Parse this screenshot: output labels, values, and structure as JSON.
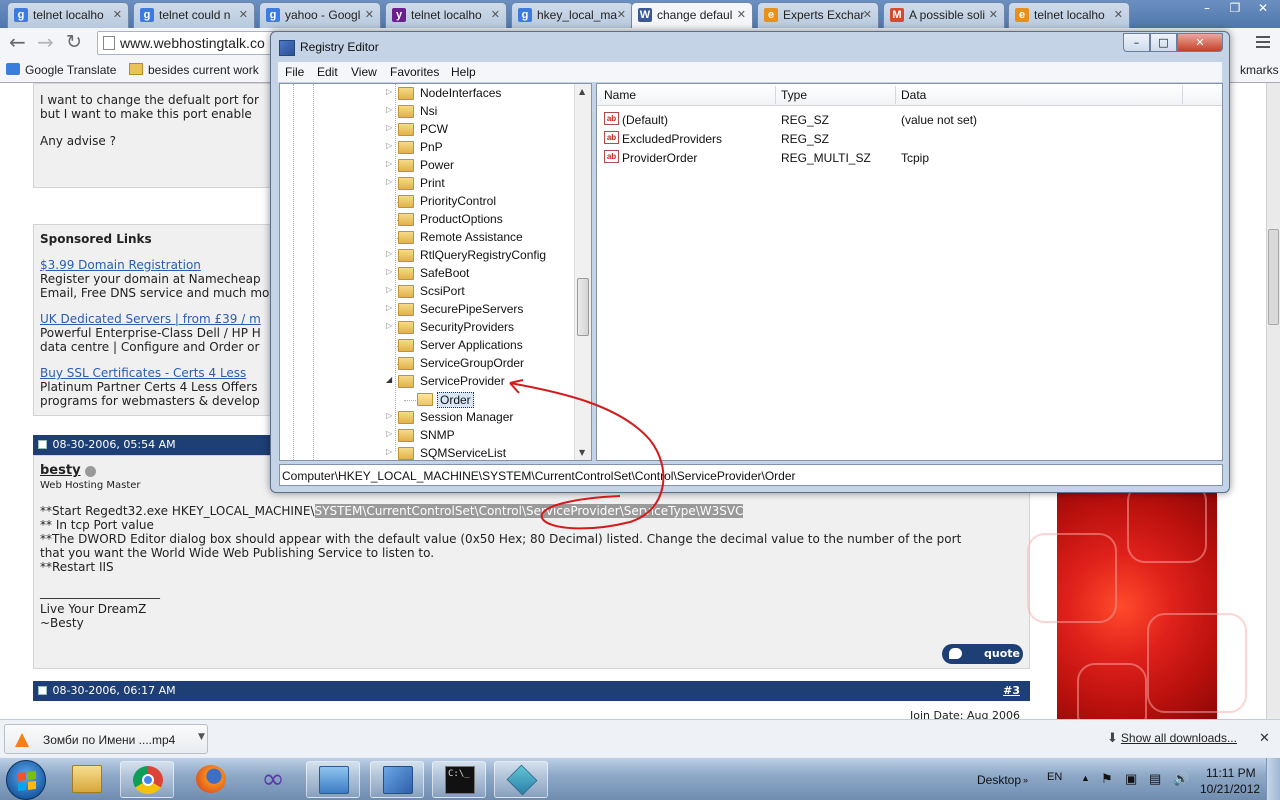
{
  "browser": {
    "tabs": [
      {
        "title": "telnet localho",
        "icon": "g",
        "color": "#3e7be0"
      },
      {
        "title": "telnet could n",
        "icon": "g",
        "color": "#3e7be0"
      },
      {
        "title": "yahoo - Googl",
        "icon": "g",
        "color": "#3e7be0"
      },
      {
        "title": "telnet localho",
        "icon": "y",
        "color": "#6b1f8f"
      },
      {
        "title": "hkey_local_ma",
        "icon": "g",
        "color": "#3e7be0"
      },
      {
        "title": "change defaul",
        "icon": "W",
        "color": "#3b5a94"
      },
      {
        "title": "Experts Exchar",
        "icon": "e",
        "color": "#e8901c"
      },
      {
        "title": "A possible soli",
        "icon": "M",
        "color": "#d44b2f"
      },
      {
        "title": "telnet localho",
        "icon": "e",
        "color": "#e8901c"
      }
    ],
    "url": "www.webhostingtalk.co",
    "bookmarks": [
      {
        "label": "Google Translate"
      },
      {
        "label": "besides current work"
      },
      {
        "label": "kmarks"
      }
    ]
  },
  "page": {
    "question_lines": [
      "I want to change the defualt port for",
      "but I want to make this port enable"
    ],
    "question_ask": "Any advise ?",
    "sponsored_title": "Sponsored Links",
    "ads": [
      {
        "link": "$3.99 Domain Registration",
        "lines": [
          "Register your domain at Namecheap",
          "Email, Free DNS service and much mo"
        ]
      },
      {
        "link": "UK Dedicated Servers | from £39 / m",
        "lines": [
          "Powerful Enterprise-Class Dell / HP H",
          "data centre | Configure and Order or"
        ]
      },
      {
        "link": "Buy SSL Certificates - Certs 4 Less",
        "lines": [
          "Platinum Partner Certs 4 Less Offers",
          "programs for webmasters & develop"
        ]
      }
    ],
    "post1": {
      "date": "08-30-2006, 05:54 AM",
      "author": "besty",
      "role": "Web Hosting Master",
      "body_line1_plain": "**Start Regedt32.exe HKEY_LOCAL_MACHINE\\",
      "body_line1_highlight": "SYSTEM\\CurrentControlSet\\Control\\ServiceProvider\\ServiceType\\W3SVC",
      "body_lines": [
        "** In tcp Port value",
        "**The DWORD Editor dialog box should appear with the default value (0x50 Hex; 80 Decimal) listed. Change the decimal value to the number of the port",
        "that you want the World Wide Web Publishing Service to listen to.",
        "**Restart IIS"
      ],
      "sig_rule": "____________________",
      "signature": [
        "Live Your DreamZ",
        "~Besty"
      ],
      "quote_label": "quote"
    },
    "post2": {
      "date": "08-30-2006, 06:17 AM",
      "number": "#3",
      "join_date": "Join Date: Aug 2006"
    }
  },
  "regedit": {
    "title": "Registry Editor",
    "menu": [
      "File",
      "Edit",
      "View",
      "Favorites",
      "Help"
    ],
    "tree": [
      {
        "label": "NodeInterfaces",
        "expander": "collapsed"
      },
      {
        "label": "Nsi",
        "expander": "collapsed"
      },
      {
        "label": "PCW",
        "expander": "collapsed"
      },
      {
        "label": "PnP",
        "expander": "collapsed"
      },
      {
        "label": "Power",
        "expander": "collapsed"
      },
      {
        "label": "Print",
        "expander": "collapsed"
      },
      {
        "label": "PriorityControl",
        "expander": "none"
      },
      {
        "label": "ProductOptions",
        "expander": "none"
      },
      {
        "label": "Remote Assistance",
        "expander": "none"
      },
      {
        "label": "RtlQueryRegistryConfig",
        "expander": "collapsed"
      },
      {
        "label": "SafeBoot",
        "expander": "collapsed"
      },
      {
        "label": "ScsiPort",
        "expander": "collapsed"
      },
      {
        "label": "SecurePipeServers",
        "expander": "collapsed"
      },
      {
        "label": "SecurityProviders",
        "expander": "collapsed"
      },
      {
        "label": "Server Applications",
        "expander": "none"
      },
      {
        "label": "ServiceGroupOrder",
        "expander": "none"
      },
      {
        "label": "ServiceProvider",
        "expander": "expanded"
      },
      {
        "label": "Order",
        "expander": "child-selected"
      },
      {
        "label": "Session Manager",
        "expander": "collapsed"
      },
      {
        "label": "SNMP",
        "expander": "collapsed"
      },
      {
        "label": "SQMServiceList",
        "expander": "collapsed"
      }
    ],
    "columns": [
      "Name",
      "Type",
      "Data"
    ],
    "values": [
      {
        "name": "(Default)",
        "type": "REG_SZ",
        "data": "(value not set)"
      },
      {
        "name": "ExcludedProviders",
        "type": "REG_SZ",
        "data": ""
      },
      {
        "name": "ProviderOrder",
        "type": "REG_MULTI_SZ",
        "data": "Tcpip"
      }
    ],
    "status_path": "Computer\\HKEY_LOCAL_MACHINE\\SYSTEM\\CurrentControlSet\\Control\\ServiceProvider\\Order"
  },
  "downloads": {
    "item": "Зомби по Имени ....mp4",
    "show_all": "Show all downloads..."
  },
  "taskbar": {
    "desktop_label": "Desktop",
    "lang": "EN",
    "time": "11:11 PM",
    "date": "10/21/2012"
  },
  "colors": {
    "annotation": "#d41b1b",
    "post_bar": "#1e3f75",
    "link": "#2a5db0"
  }
}
